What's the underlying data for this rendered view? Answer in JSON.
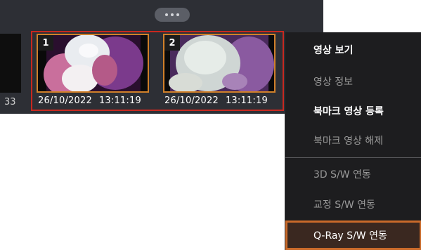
{
  "colors": {
    "selection_border": "#c8281f",
    "thumb_border": "#d0802a",
    "menu_bg": "#1d1d1f",
    "highlight_border": "#c96a2a"
  },
  "filmstrip": {
    "partial_caption": "33",
    "thumbnails": [
      {
        "index": "1",
        "date": "26/10/2022",
        "time": "13:11:19"
      },
      {
        "index": "2",
        "date": "26/10/2022",
        "time": "13:11:19"
      }
    ]
  },
  "context_menu": {
    "items": [
      {
        "label": "영상 보기",
        "enabled": true
      },
      {
        "label": "영상 정보",
        "enabled": false
      },
      {
        "label": "북마크 영상 등록",
        "enabled": true
      },
      {
        "label": "북마크 영상 해제",
        "enabled": false
      },
      {
        "label": "3D S/W 연동",
        "enabled": false
      },
      {
        "label": "교정 S/W 연동",
        "enabled": false
      },
      {
        "label": "Q-Ray S/W 연동",
        "enabled": true,
        "highlighted": true
      }
    ]
  }
}
